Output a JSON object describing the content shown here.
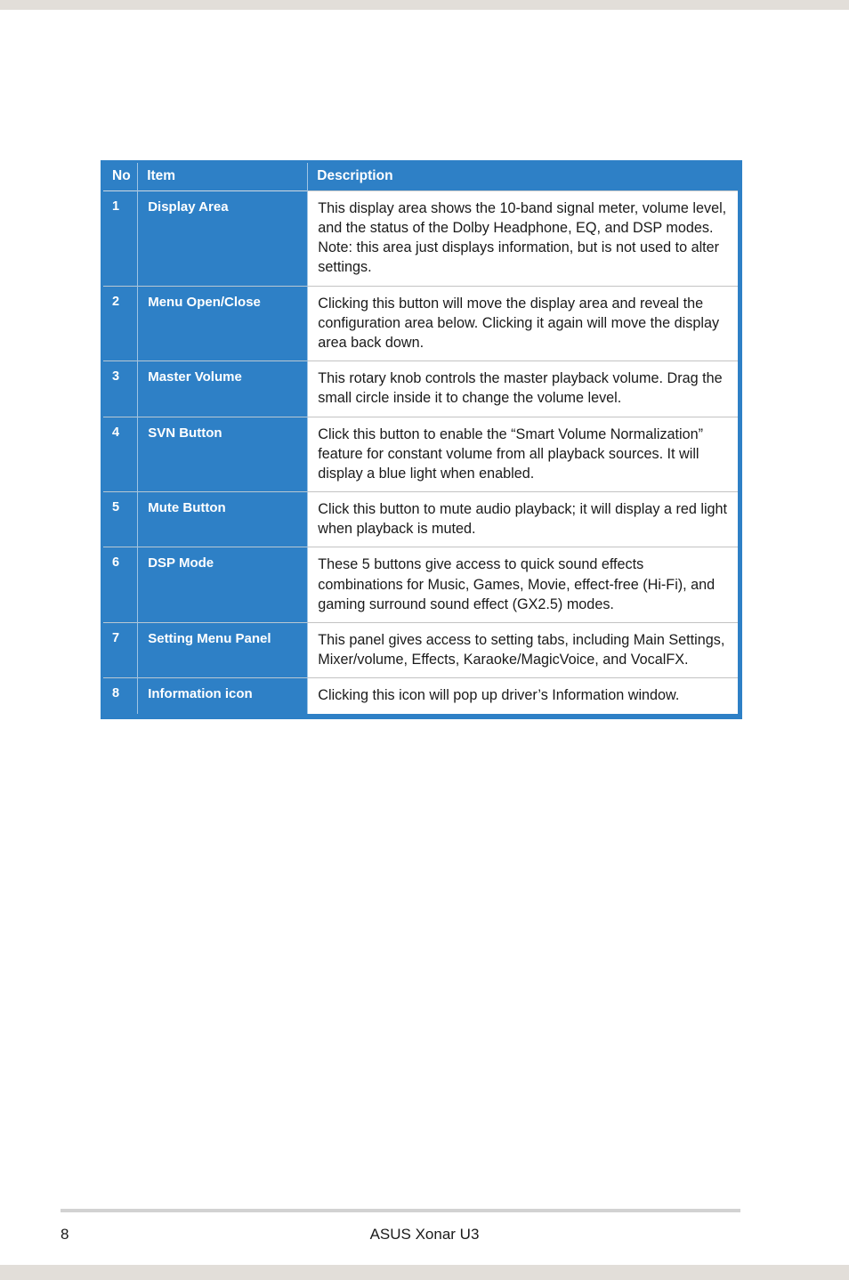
{
  "page": {
    "strip_color": "#e2ded9",
    "accent_color": "#2e80c6"
  },
  "table": {
    "headers": {
      "no": "No",
      "item": "Item",
      "description": "Description"
    },
    "rows": [
      {
        "no": "1",
        "item": "Display Area",
        "description_lines": [
          "This display area shows the 10-band signal meter, volume level, and the status of the Dolby Headphone, EQ, and DSP modes.",
          "Note: this area just displays information, but is not used to alter settings."
        ]
      },
      {
        "no": "2",
        "item": "Menu Open/Close",
        "description_lines": [
          "Clicking this button will move the display area and reveal the configuration area below. Clicking it again will move the display area back down."
        ]
      },
      {
        "no": "3",
        "item": "Master Volume",
        "description_lines": [
          "This rotary knob controls the master playback volume. Drag the small circle inside it to change the volume level."
        ]
      },
      {
        "no": "4",
        "item": "SVN Button",
        "description_lines": [
          "Click this button to enable the “Smart Volume Normalization” feature for constant volume from all playback sources. It will display a blue light when enabled."
        ]
      },
      {
        "no": "5",
        "item": "Mute Button",
        "description_lines": [
          "Click this button to mute audio playback; it will display a red light when playback is muted."
        ]
      },
      {
        "no": "6",
        "item": "DSP Mode",
        "description_lines": [
          "These 5 buttons give access to quick sound effects combinations for Music, Games, Movie, effect-free (Hi-Fi), and gaming surround sound effect (GX2.5) modes."
        ]
      },
      {
        "no": "7",
        "item": "Setting Menu Panel",
        "description_lines": [
          "This panel gives access to setting tabs, including Main Settings, Mixer/volume, Effects, Karaoke/MagicVoice, and VocalFX."
        ]
      },
      {
        "no": "8",
        "item": "Information icon",
        "description_lines": [
          "Clicking this icon will pop up driver’s Information window."
        ]
      }
    ]
  },
  "footer": {
    "page_number": "8",
    "title": "ASUS Xonar U3"
  }
}
